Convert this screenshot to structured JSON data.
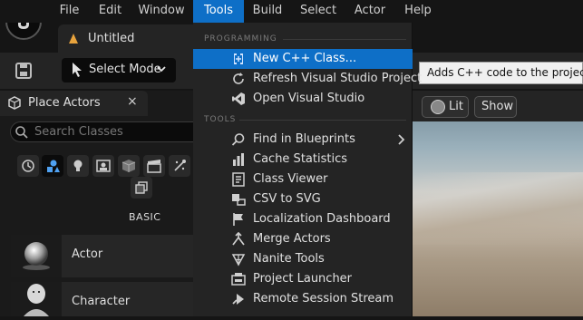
{
  "menubar": {
    "items": [
      "File",
      "Edit",
      "Window",
      "Tools",
      "Build",
      "Select",
      "Actor",
      "Help"
    ],
    "active": "Tools"
  },
  "tab": {
    "title": "Untitled"
  },
  "toolbar": {
    "mode_label": "Select Mode"
  },
  "place_actors": {
    "title": "Place Actors",
    "close": "×",
    "search_placeholder": "Search Classes",
    "category_label": "BASIC",
    "actors": [
      "Actor",
      "Character"
    ]
  },
  "viewport": {
    "lit_label": "Lit",
    "show_label": "Show"
  },
  "tooltip": {
    "text": "Adds C++ code to the project. Th"
  },
  "tools_menu": {
    "section_programming": "PROGRAMMING",
    "section_tools": "TOOLS",
    "items": [
      {
        "label": "New C++ Class...",
        "icon": "cpp-class-icon",
        "highlighted": true
      },
      {
        "label": "Refresh Visual Studio Project",
        "icon": "refresh-icon"
      },
      {
        "label": "Open Visual Studio",
        "icon": "visual-studio-icon"
      },
      {
        "label": "Find in Blueprints",
        "icon": "find-icon",
        "submenu": true
      },
      {
        "label": "Cache Statistics",
        "icon": "statistics-icon"
      },
      {
        "label": "Class Viewer",
        "icon": "class-viewer-icon"
      },
      {
        "label": "CSV to SVG",
        "icon": "csv-icon"
      },
      {
        "label": "Localization Dashboard",
        "icon": "flag-icon"
      },
      {
        "label": "Merge Actors",
        "icon": "merge-icon"
      },
      {
        "label": "Nanite Tools",
        "icon": "nanite-icon"
      },
      {
        "label": "Project Launcher",
        "icon": "launcher-icon"
      },
      {
        "label": "Remote Session Stream",
        "icon": "stream-icon"
      }
    ]
  },
  "colors": {
    "accent": "#0e6fc7",
    "menu_bg": "#242424",
    "bar_bg": "#151515"
  }
}
